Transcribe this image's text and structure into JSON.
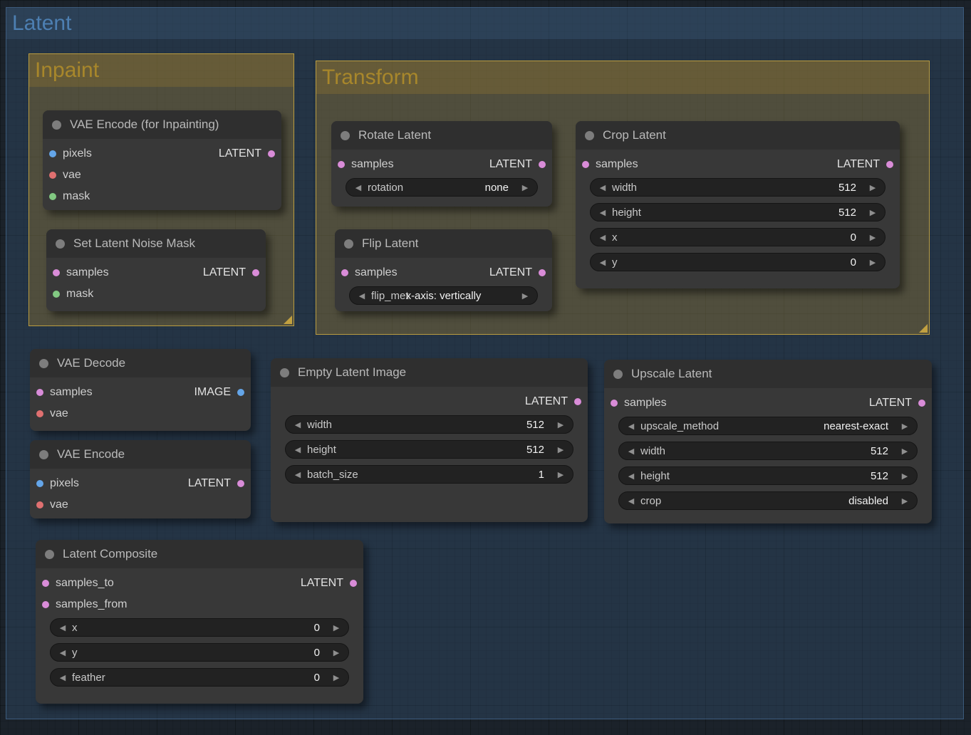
{
  "icons": {
    "left_arrow": "◀",
    "right_arrow": "▶"
  },
  "colors": {
    "latent": "#d98cd8",
    "image": "#64a5e8",
    "vae": "#e07070",
    "mask": "#82c982",
    "root_group_title": "#4d7fb2",
    "sub_group_title": "#a8872b"
  },
  "root_group": {
    "title": "Latent"
  },
  "groups": {
    "inpaint": {
      "title": "Inpaint"
    },
    "transform": {
      "title": "Transform"
    }
  },
  "nodes": {
    "vae_encode_inpaint": {
      "title": "VAE Encode (for Inpainting)",
      "inputs": [
        {
          "name": "pixels"
        },
        {
          "name": "vae"
        },
        {
          "name": "mask"
        }
      ],
      "outputs": [
        {
          "name": "LATENT"
        }
      ]
    },
    "set_latent_noise_mask": {
      "title": "Set Latent Noise Mask",
      "inputs": [
        {
          "name": "samples"
        },
        {
          "name": "mask"
        }
      ],
      "outputs": [
        {
          "name": "LATENT"
        }
      ]
    },
    "rotate_latent": {
      "title": "Rotate Latent",
      "inputs": [
        {
          "name": "samples"
        }
      ],
      "outputs": [
        {
          "name": "LATENT"
        }
      ],
      "widgets": [
        {
          "label": "rotation",
          "value": "none"
        }
      ]
    },
    "flip_latent": {
      "title": "Flip Latent",
      "inputs": [
        {
          "name": "samples"
        }
      ],
      "outputs": [
        {
          "name": "LATENT"
        }
      ],
      "widgets": [
        {
          "label": "flip_met",
          "value": "x-axis: vertically"
        }
      ]
    },
    "crop_latent": {
      "title": "Crop Latent",
      "inputs": [
        {
          "name": "samples"
        }
      ],
      "outputs": [
        {
          "name": "LATENT"
        }
      ],
      "widgets": [
        {
          "label": "width",
          "value": "512"
        },
        {
          "label": "height",
          "value": "512"
        },
        {
          "label": "x",
          "value": "0"
        },
        {
          "label": "y",
          "value": "0"
        }
      ]
    },
    "vae_decode": {
      "title": "VAE Decode",
      "inputs": [
        {
          "name": "samples"
        },
        {
          "name": "vae"
        }
      ],
      "outputs": [
        {
          "name": "IMAGE"
        }
      ]
    },
    "vae_encode": {
      "title": "VAE Encode",
      "inputs": [
        {
          "name": "pixels"
        },
        {
          "name": "vae"
        }
      ],
      "outputs": [
        {
          "name": "LATENT"
        }
      ]
    },
    "empty_latent_image": {
      "title": "Empty Latent Image",
      "outputs": [
        {
          "name": "LATENT"
        }
      ],
      "widgets": [
        {
          "label": "width",
          "value": "512"
        },
        {
          "label": "height",
          "value": "512"
        },
        {
          "label": "batch_size",
          "value": "1"
        }
      ]
    },
    "upscale_latent": {
      "title": "Upscale Latent",
      "inputs": [
        {
          "name": "samples"
        }
      ],
      "outputs": [
        {
          "name": "LATENT"
        }
      ],
      "widgets": [
        {
          "label": "upscale_method",
          "value": "nearest-exact"
        },
        {
          "label": "width",
          "value": "512"
        },
        {
          "label": "height",
          "value": "512"
        },
        {
          "label": "crop",
          "value": "disabled"
        }
      ]
    },
    "latent_composite": {
      "title": "Latent Composite",
      "inputs": [
        {
          "name": "samples_to"
        },
        {
          "name": "samples_from"
        }
      ],
      "outputs": [
        {
          "name": "LATENT"
        }
      ],
      "widgets": [
        {
          "label": "x",
          "value": "0"
        },
        {
          "label": "y",
          "value": "0"
        },
        {
          "label": "feather",
          "value": "0"
        }
      ]
    }
  }
}
